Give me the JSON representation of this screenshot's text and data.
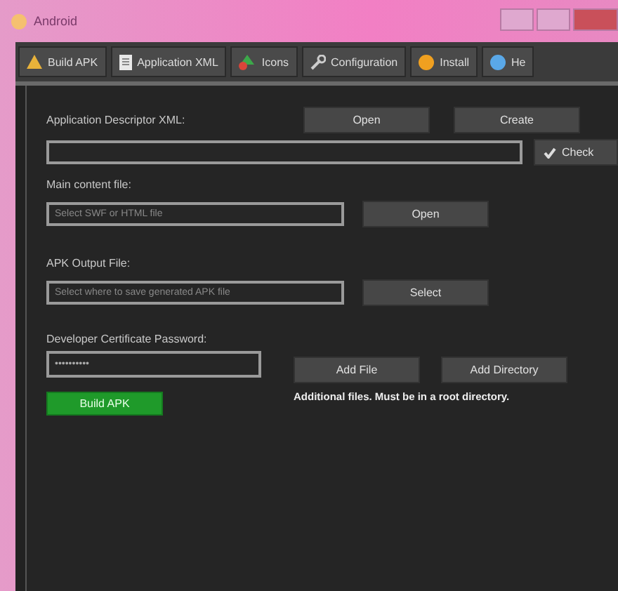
{
  "window": {
    "title": "Android"
  },
  "tabs": [
    {
      "label": "Build APK"
    },
    {
      "label": "Application XML"
    },
    {
      "label": "Icons"
    },
    {
      "label": "Configuration"
    },
    {
      "label": "Install"
    },
    {
      "label": "He"
    }
  ],
  "descriptor": {
    "label": "Application Descriptor XML:",
    "buttons": [
      "Open",
      "Create"
    ],
    "check_button": "Check"
  },
  "main_content": {
    "label": "Main content file:",
    "placeholder": "Select SWF or HTML file",
    "button": "Open"
  },
  "output": {
    "label": "APK Output File:",
    "placeholder": "Select where to save generated APK file",
    "button": "Select"
  },
  "certificate": {
    "label": "Developer Certificate Password:",
    "value": "••••••••••"
  },
  "build_button": "Build APK",
  "extra_files": {
    "buttons": [
      "Add File",
      "Add Directory"
    ],
    "note": "Additional files. Must be in a root directory."
  }
}
